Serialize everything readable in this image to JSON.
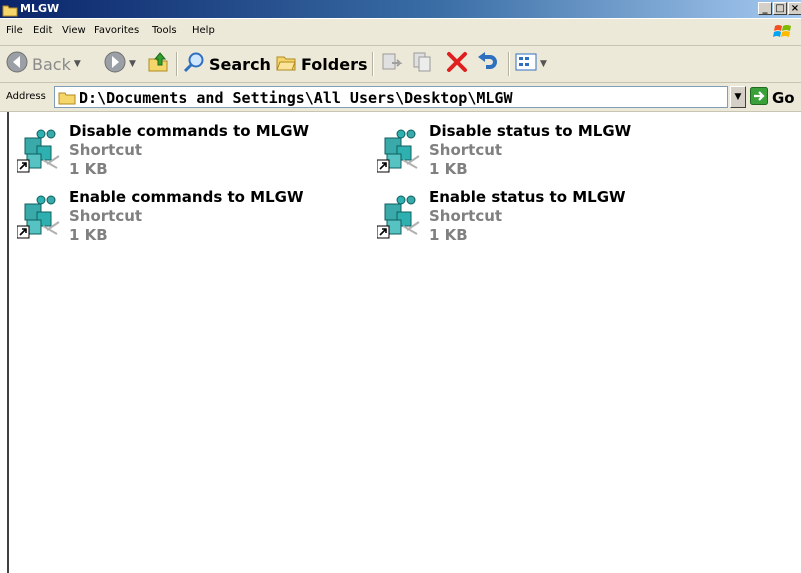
{
  "window": {
    "title": "MLGW"
  },
  "caption_buttons": {
    "minimize": "_",
    "maximize": "□",
    "close": "×"
  },
  "menu": [
    "File",
    "Edit",
    "View",
    "Favorites",
    "Tools",
    "Help"
  ],
  "toolbar": {
    "back_label": "Back",
    "search_label": "Search",
    "folders_label": "Folders"
  },
  "address": {
    "label": "Address",
    "value": "D:\\Documents and Settings\\All Users\\Desktop\\MLGW",
    "go_label": "Go"
  },
  "files": [
    {
      "name": "Disable commands to MLGW",
      "type": "Shortcut",
      "size": "1 KB"
    },
    {
      "name": "Disable status to MLGW",
      "type": "Shortcut",
      "size": "1 KB"
    },
    {
      "name": "Enable commands to MLGW",
      "type": "Shortcut",
      "size": "1 KB"
    },
    {
      "name": "Enable status to MLGW",
      "type": "Shortcut",
      "size": "1 KB"
    }
  ],
  "colors": {
    "titlebar_start": "#0a246a",
    "titlebar_end": "#a6caf0",
    "chrome": "#ece9d8",
    "dim_text": "#808080",
    "delete_red": "#e02020"
  },
  "icons": [
    "folder-icon",
    "windows-logo-icon",
    "back-arrow-icon",
    "forward-arrow-icon",
    "up-folder-icon",
    "search-icon",
    "folders-icon",
    "move-to-icon",
    "copy-to-icon",
    "delete-icon",
    "undo-icon",
    "views-icon",
    "go-arrow-icon",
    "shortcut-icon"
  ]
}
